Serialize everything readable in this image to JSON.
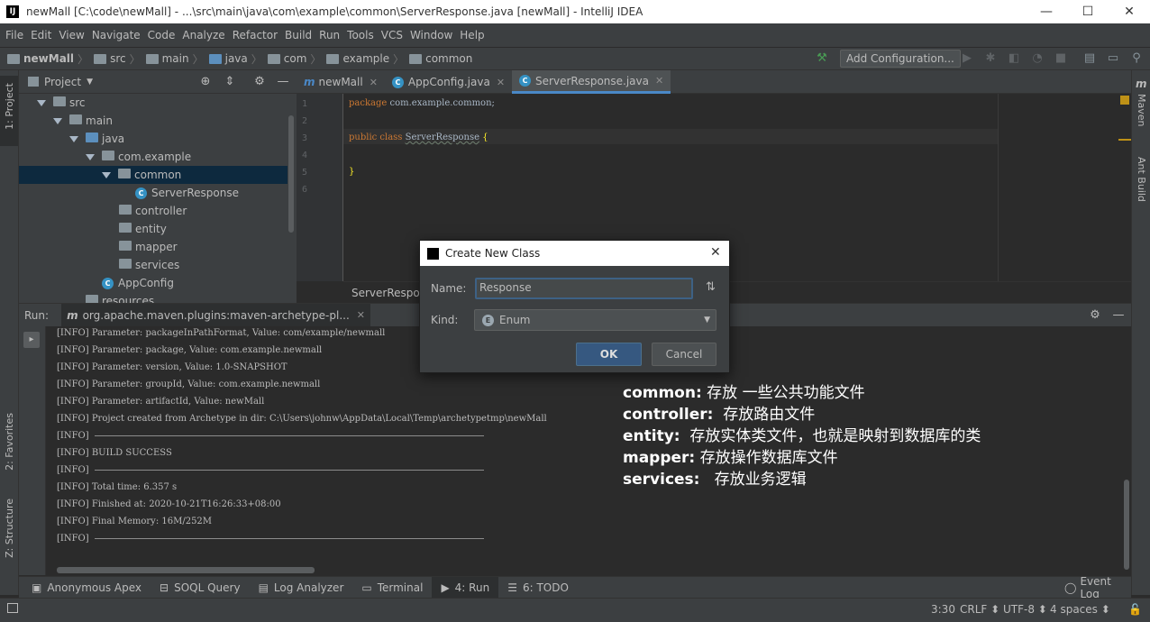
{
  "window": {
    "title": "newMall [C:\\code\\newMall] - ...\\src\\main\\java\\com\\example\\common\\ServerResponse.java [newMall] - IntelliJ IDEA",
    "minimize": "—",
    "maximize": "☐",
    "close": "✕"
  },
  "menu": [
    "File",
    "Edit",
    "View",
    "Navigate",
    "Code",
    "Analyze",
    "Refactor",
    "Build",
    "Run",
    "Tools",
    "VCS",
    "Window",
    "Help"
  ],
  "breadcrumb": [
    "newMall",
    "src",
    "main",
    "java",
    "com",
    "example",
    "common"
  ],
  "toolbar": {
    "add_config": "Add Configuration..."
  },
  "left_tools": {
    "project": "1: Project",
    "favorites": "2: Favorites",
    "structure": "Z: Structure"
  },
  "right_tools": {
    "maven": "Maven",
    "ant": "Ant Build"
  },
  "project_panel": {
    "title": "Project"
  },
  "tree": [
    {
      "label": "src",
      "kind": "folder"
    },
    {
      "label": "main",
      "kind": "folder"
    },
    {
      "label": "java",
      "kind": "folder-blue"
    },
    {
      "label": "com.example",
      "kind": "folder"
    },
    {
      "label": "common",
      "kind": "folder"
    },
    {
      "label": "ServerResponse",
      "kind": "class"
    },
    {
      "label": "controller",
      "kind": "folder"
    },
    {
      "label": "entity",
      "kind": "folder"
    },
    {
      "label": "mapper",
      "kind": "folder"
    },
    {
      "label": "services",
      "kind": "folder"
    },
    {
      "label": "AppConfig",
      "kind": "class"
    },
    {
      "label": "resources",
      "kind": "folder"
    }
  ],
  "editor_tabs": [
    {
      "label": "newMall",
      "icon": "m"
    },
    {
      "label": "AppConfig.java",
      "icon": "C"
    },
    {
      "label": "ServerResponse.java",
      "icon": "C",
      "active": true
    }
  ],
  "code": {
    "line_numbers": [
      "1",
      "2",
      "3",
      "4",
      "5",
      "6"
    ],
    "line1_kw": "package",
    "line1_rest": " com.example.common;",
    "line3_kw": "public class",
    "line3_name": "ServerResponse",
    "line3_brace": " {",
    "line5": "}"
  },
  "editor_footer": "ServerResponse",
  "run": {
    "label": "Run:",
    "tab": "org.apache.maven.plugins:maven-archetype-pl...",
    "lines": [
      "[INFO] Parameter: packageInPathFormat, Value: com/example/newmall",
      "[INFO] Parameter: package, Value: com.example.newmall",
      "[INFO] Parameter: version, Value: 1.0-SNAPSHOT",
      "[INFO] Parameter: groupId, Value: com.example.newmall",
      "[INFO] Parameter: artifactId, Value: newMall",
      "[INFO] Project created from Archetype in dir: C:\\Users\\johnw\\AppData\\Local\\Temp\\archetypetmp\\newMall",
      "[INFO]",
      "[INFO] BUILD SUCCESS",
      "[INFO]",
      "[INFO] Total time: 6.357 s",
      "[INFO] Finished at: 2020-10-21T16:26:33+08:00",
      "[INFO] Final Memory: 16M/252M",
      "[INFO]"
    ]
  },
  "notes": [
    {
      "key": "common:",
      "text": " 存放 一些公共功能文件"
    },
    {
      "key": "controller:",
      "text": "  存放路由文件"
    },
    {
      "key": "entity:",
      "text": "  存放实体类文件，也就是映射到数据库的类"
    },
    {
      "key": "mapper:",
      "text": " 存放操作数据库文件"
    },
    {
      "key": "services:",
      "text": "   存放业务逻辑"
    }
  ],
  "bottom_tools": [
    "Anonymous Apex",
    "SOQL Query",
    "Log Analyzer",
    "Terminal",
    "4: Run",
    "6: TODO"
  ],
  "event_log": "Event Log",
  "status": {
    "position": "3:30",
    "line_sep": "CRLF",
    "encoding": "UTF-8",
    "indent": "4 spaces"
  },
  "dialog": {
    "title": "Create New Class",
    "name_label": "Name:",
    "name_value": "Response",
    "kind_label": "Kind:",
    "kind_value": "Enum",
    "ok": "OK",
    "cancel": "Cancel"
  }
}
